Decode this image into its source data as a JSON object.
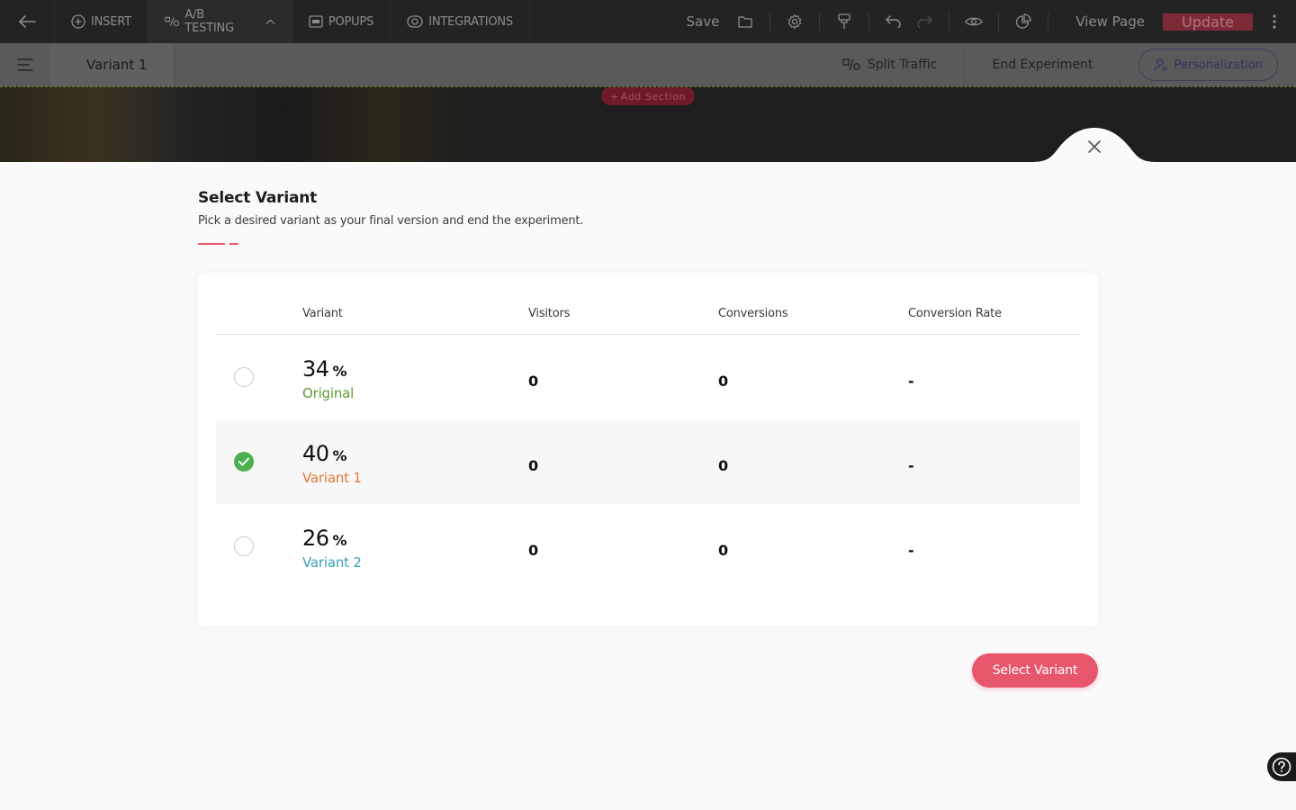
{
  "topbar": {
    "tabs": [
      {
        "icon": "plus-circle-icon",
        "label": "INSERT"
      },
      {
        "icon": "ab-icon",
        "label": "A/B TESTING"
      },
      {
        "icon": "popup-icon",
        "label": "POPUPS"
      },
      {
        "icon": "integrations-icon",
        "label": "INTEGRATIONS"
      }
    ],
    "save_label": "Save",
    "view_page_label": "View Page",
    "update_label": "Update"
  },
  "subbar": {
    "current_variant": "Variant 1",
    "split_traffic_label": "Split Traffic",
    "end_experiment_label": "End Experiment",
    "personalization_label": "Personalization"
  },
  "canvas": {
    "add_section_label": "Add Section"
  },
  "modal": {
    "title": "Select Variant",
    "subtitle": "Pick a desired variant as your final version and end the experiment.",
    "columns": [
      "Variant",
      "Visitors",
      "Conversions",
      "Conversion Rate"
    ],
    "percent_symbol": "%",
    "rows": [
      {
        "percent": "34",
        "name": "Original",
        "color": "#5b9a2f",
        "visitors": "0",
        "conversions": "0",
        "rate": "-",
        "selected": false
      },
      {
        "percent": "40",
        "name": "Variant 1",
        "color": "#e07b39",
        "visitors": "0",
        "conversions": "0",
        "rate": "-",
        "selected": true
      },
      {
        "percent": "26",
        "name": "Variant 2",
        "color": "#3aa0b8",
        "visitors": "0",
        "conversions": "0",
        "rate": "-",
        "selected": false
      }
    ],
    "select_button_label": "Select Variant",
    "accent_color": "#e8566c"
  }
}
